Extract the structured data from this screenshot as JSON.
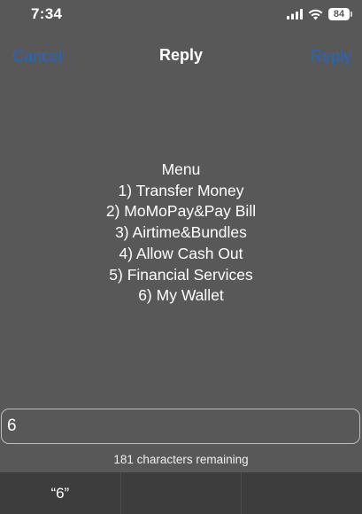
{
  "status_bar": {
    "time": "7:34",
    "battery": "84",
    "icons": [
      "cellular-signal-icon",
      "wifi-icon",
      "battery-icon"
    ]
  },
  "nav": {
    "cancel_label": "Cancel",
    "title": "Reply",
    "reply_label": "Reply",
    "accent_color": "#1f68c4"
  },
  "message": {
    "lines": [
      "Menu",
      "1) Transfer Money",
      "2) MoMoPay&Pay Bill",
      "3) Airtime&Bundles",
      "4) Allow Cash Out",
      "5) Financial Services",
      "6) My Wallet"
    ]
  },
  "reply_input": {
    "value": "6"
  },
  "counter_text": "181 characters remaining",
  "keyboard_suggestions": [
    "“6”",
    "",
    ""
  ],
  "colors": {
    "background": "#585858",
    "suggestion_bar": "#3d3d3d"
  }
}
